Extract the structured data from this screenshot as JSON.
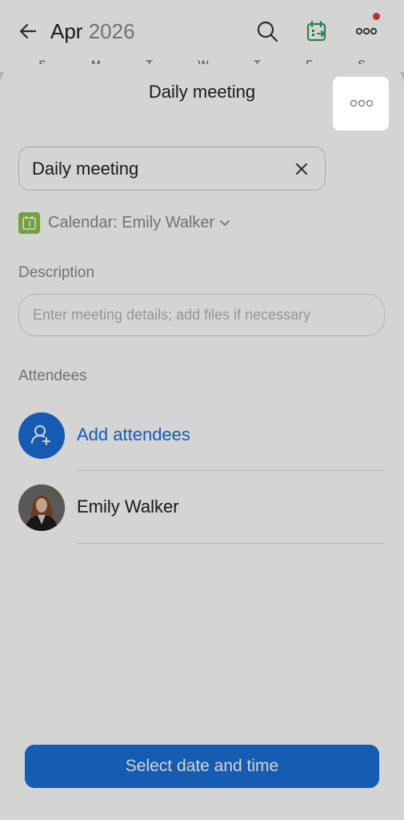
{
  "header": {
    "month": "Apr",
    "year": "2026",
    "weekdays": [
      "S",
      "M",
      "T",
      "W",
      "T",
      "F",
      "S"
    ]
  },
  "sheet": {
    "title": "Daily meeting",
    "event_title_value": "Daily meeting",
    "calendar_label": "Calendar: Emily Walker",
    "description_label": "Description",
    "description_placeholder": "Enter meeting details; add files if necessary",
    "attendees_label": "Attendees",
    "add_attendees_label": "Add attendees",
    "attendees": [
      {
        "name": "Emily Walker"
      }
    ],
    "primary_button_label": "Select date and time"
  },
  "colors": {
    "accent": "#1a6fd6",
    "calendar_badge": "#8bc34a",
    "notification_dot": "#e53935"
  },
  "icons": {
    "back": "arrow-left-icon",
    "search": "search-icon",
    "calendar_switch": "calendar-icon",
    "more": "more-icon",
    "close": "close-icon",
    "clear": "clear-icon",
    "add_person": "add-person-icon"
  }
}
